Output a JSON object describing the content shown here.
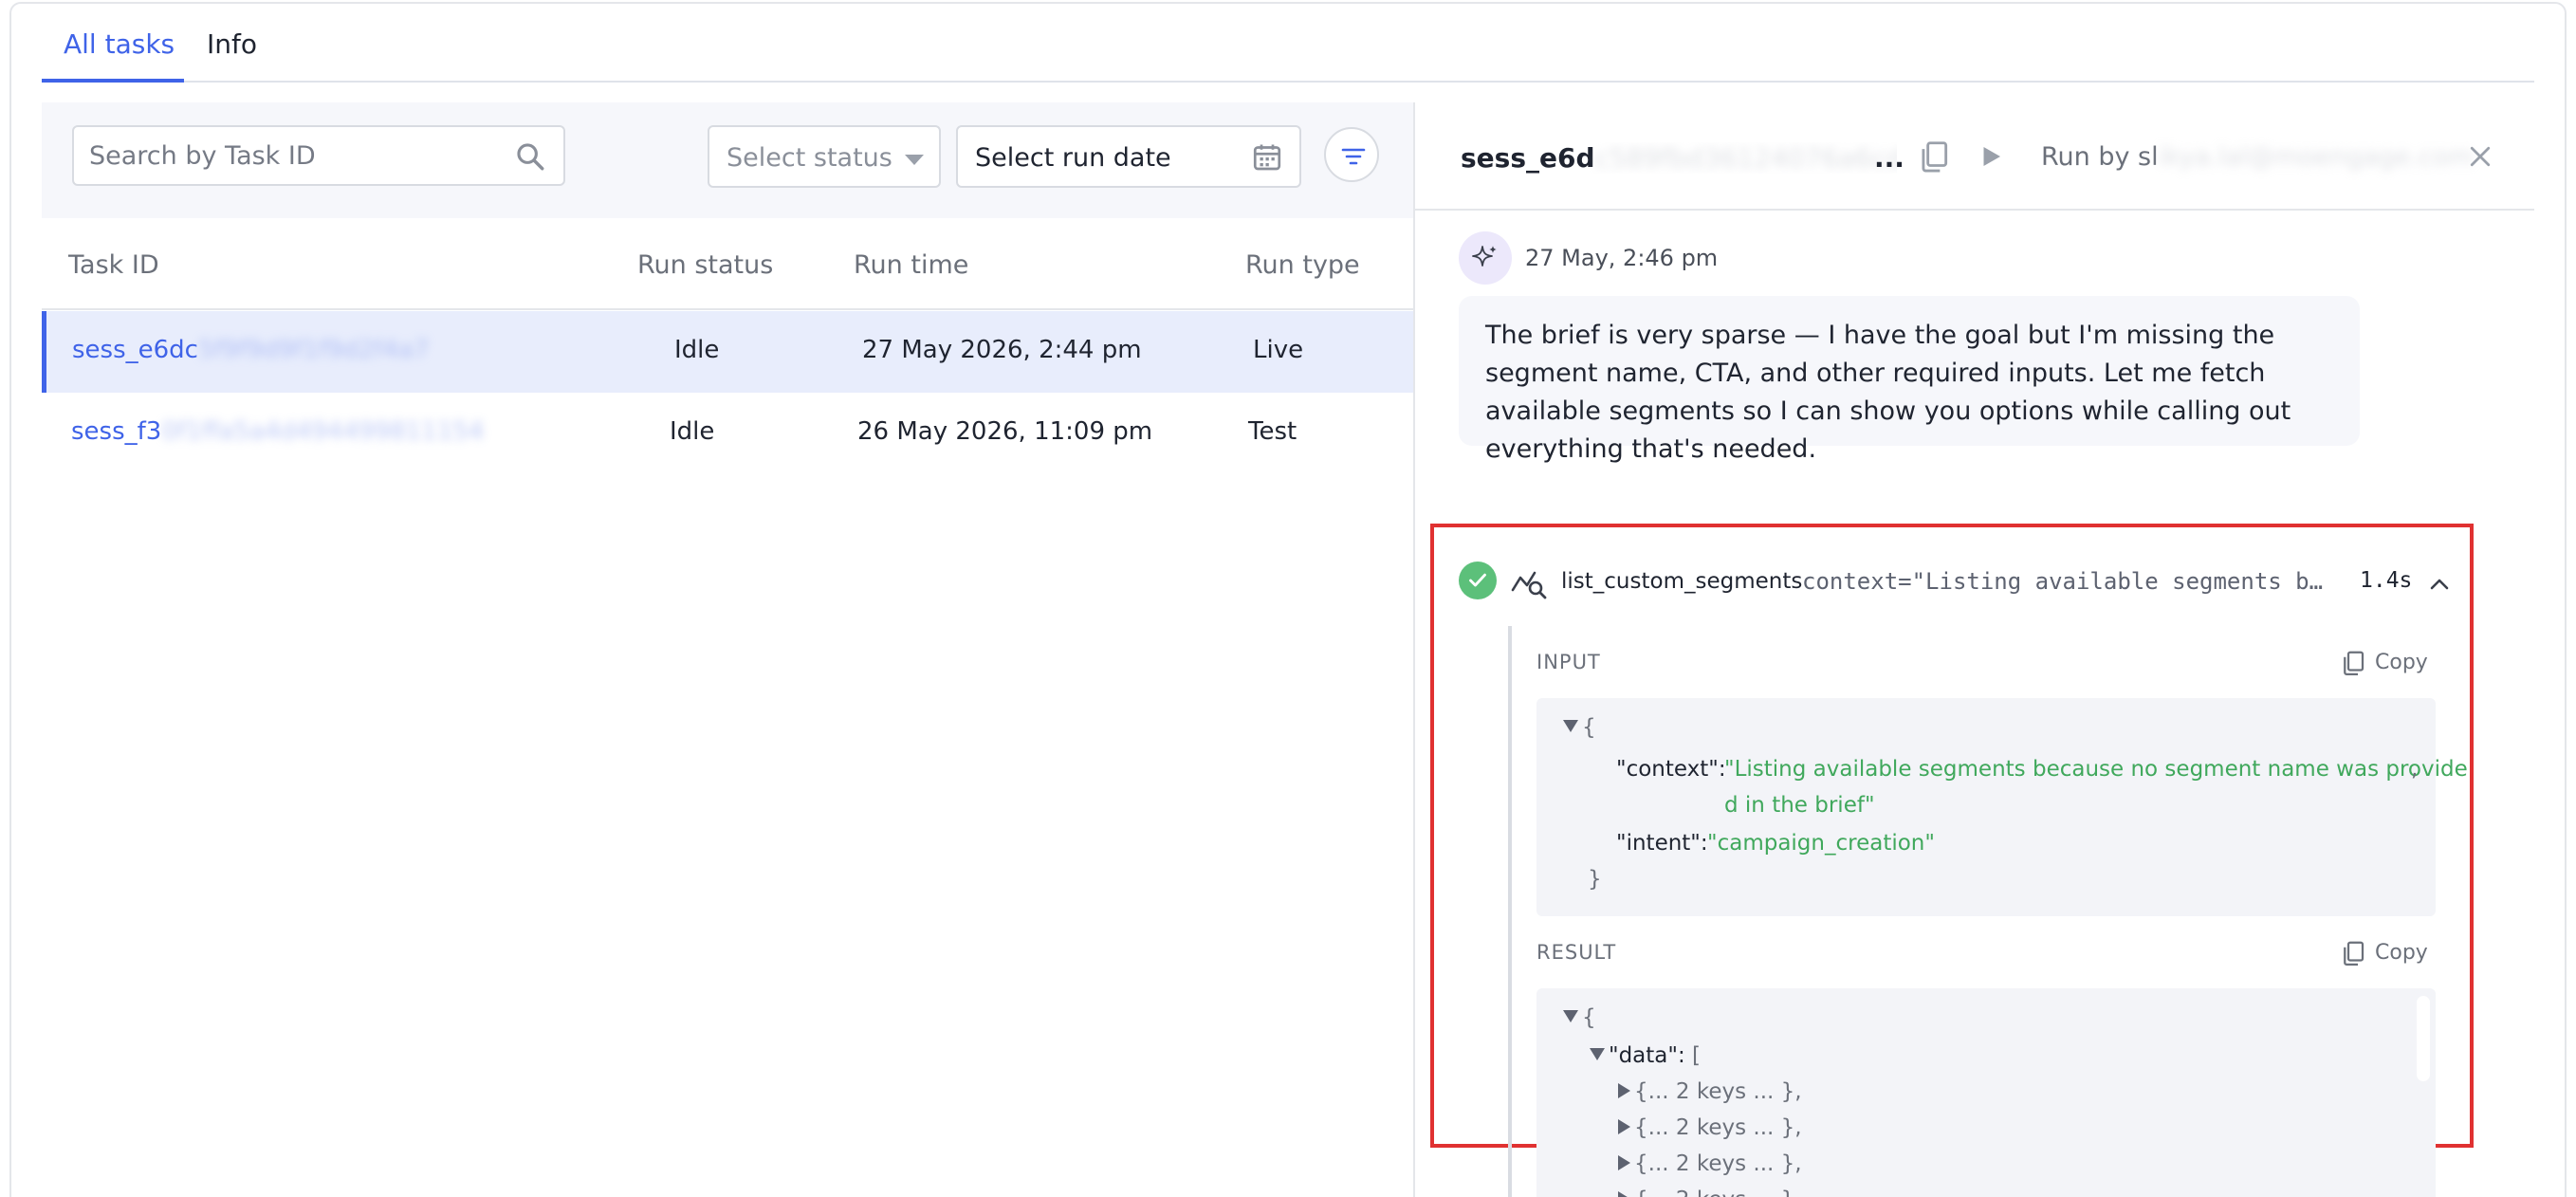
{
  "tabs": {
    "all_tasks": "All tasks",
    "info": "Info"
  },
  "filters": {
    "search_placeholder": "Search by Task ID",
    "status_placeholder": "Select status",
    "date_placeholder": "Select run date"
  },
  "table": {
    "headers": {
      "task_id": "Task ID",
      "run_status": "Run status",
      "run_time": "Run time",
      "run_type": "Run type"
    },
    "rows": [
      {
        "id_visible": "sess_e6dc",
        "id_hidden": "5f9f9d9f1f9d2f4a7",
        "status": "Idle",
        "time": "27 May 2026, 2:44 pm",
        "type": "Live"
      },
      {
        "id_visible": "sess_f3",
        "id_hidden": "0f1ffa5a4d494499811154",
        "status": "Idle",
        "time": "26 May 2026, 11:09 pm",
        "type": "Test"
      }
    ]
  },
  "detail": {
    "title_visible": "sess_e6d",
    "title_hidden": "c589fbd36124076a6cdeb",
    "ellipsis": "...",
    "run_by_prefix": "Run by sl",
    "run_by_hidden": "ikya.lal@moengage.com",
    "message": {
      "time": "27 May, 2:46 pm",
      "text": "The brief is very sparse — I have the goal but I'm missing the segment name, CTA, and other required inputs. Let me fetch available segments so I can show you options while calling out everything that's needed."
    },
    "tool_call": {
      "name": "list_custom_segments",
      "context_preview": "context=\"Listing available segments because no segment name was provided in the brief\"",
      "duration": "1.4s",
      "input_label": "INPUT",
      "result_label": "RESULT",
      "copy_label": "Copy",
      "input": {
        "open_brace": "{",
        "close_brace": "}",
        "context_key": "\"context\":",
        "context_val_1": "\"Listing available segments because no segment name was provide",
        "context_val_2": "d in the brief\"",
        "comma": ",",
        "intent_key": "\"intent\":",
        "intent_val": "\"campaign_creation\""
      },
      "result": {
        "open_brace": "{",
        "data_key": "\"data\":",
        "open_bracket": "[",
        "collapsed_item": "{... 2 keys ... },"
      }
    }
  },
  "colors": {
    "accent": "#3f63e8",
    "success": "#5cc07a",
    "json_string": "#40a85c",
    "highlight": "#e03131"
  }
}
